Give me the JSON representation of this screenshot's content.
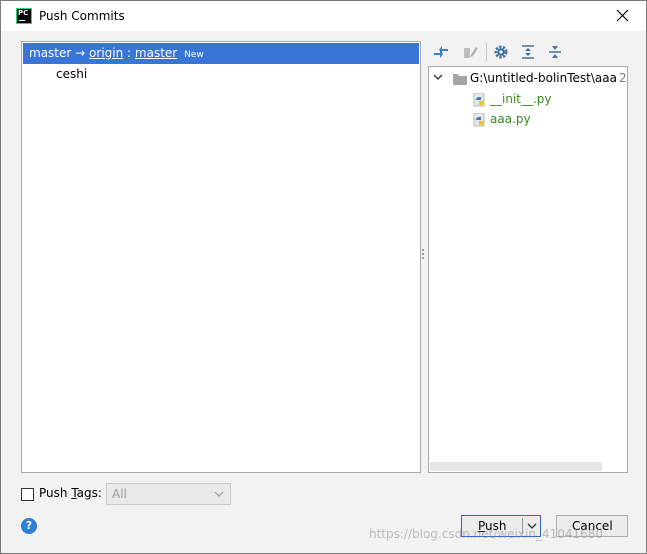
{
  "window": {
    "title": "Push Commits",
    "app_icon_text": "PC"
  },
  "branch": {
    "local": "master",
    "arrow": "→",
    "remote": "origin",
    "separator": ":",
    "remote_branch": "master",
    "badge": "New"
  },
  "commits": [
    {
      "message": "ceshi"
    }
  ],
  "toolbar": {
    "icons": [
      "show-diff-icon",
      "edit-source-icon",
      "settings-icon",
      "expand-all-icon",
      "collapse-all-icon"
    ]
  },
  "changes": {
    "root_path": "G:\\untitled-bolinTest\\aaa",
    "root_count": "2",
    "files": [
      {
        "name": "__init__.py"
      },
      {
        "name": "aaa.py"
      }
    ]
  },
  "tags": {
    "checkbox_label_prefix": "Push ",
    "checkbox_label_mnemonic": "T",
    "checkbox_label_suffix": "ags:",
    "checked": false,
    "select_value": "All"
  },
  "buttons": {
    "help": "?",
    "push_mnemonic": "P",
    "push_rest": "ush",
    "cancel": "Cancel"
  },
  "watermark": "https://blog.csdn.net/weixin_41041680",
  "colors": {
    "selection": "#3875d7",
    "file_added": "#3a8a1d",
    "accent_border": "#2f66c7"
  }
}
